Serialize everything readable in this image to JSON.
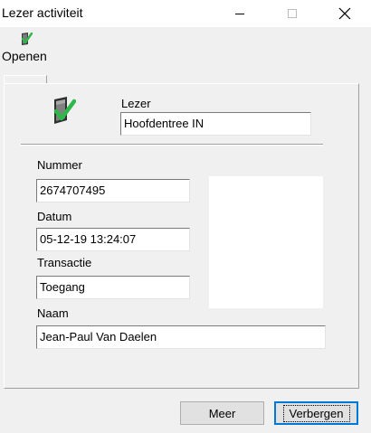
{
  "window": {
    "title": "Lezer activiteit",
    "controls": {
      "minimize_icon": "minimize-icon",
      "maximize_icon": "maximize-icon",
      "close_icon": "close-icon"
    }
  },
  "toolbar": {
    "open_label": "Openen",
    "open_icon": "door-check-icon"
  },
  "form": {
    "reader_label": "Lezer",
    "reader_value": "Hoofdentree IN",
    "number_label": "Nummer",
    "number_value": "2674707495",
    "date_label": "Datum",
    "date_value": "05-12-19 13:24:07",
    "transaction_label": "Transactie",
    "transaction_value": "Toegang",
    "name_label": "Naam",
    "name_value": "Jean-Paul Van Daelen"
  },
  "buttons": {
    "more_label": "Meer",
    "hide_label": "Verbergen"
  },
  "colors": {
    "accent": "#0078d7",
    "check_green": "#2db84a"
  }
}
